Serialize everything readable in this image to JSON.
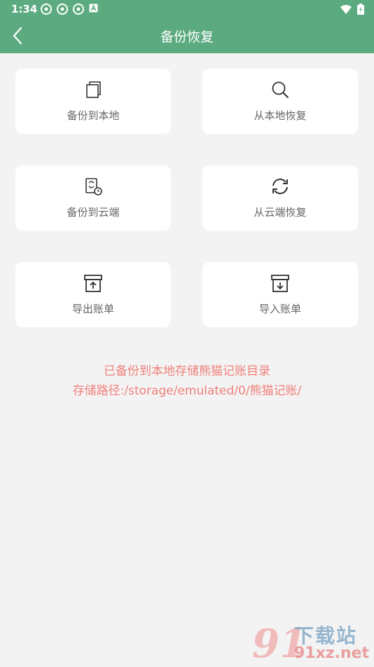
{
  "status": {
    "time": "1:34"
  },
  "header": {
    "title": "备份恢复"
  },
  "cards": [
    {
      "label": "备份到本地"
    },
    {
      "label": "从本地恢复"
    },
    {
      "label": "备份到云端"
    },
    {
      "label": "从云端恢复"
    },
    {
      "label": "导出账单"
    },
    {
      "label": "导入账单"
    }
  ],
  "info": {
    "line1": "已备份到本地存储熊猫记账目录",
    "line2": "存储路径:/storage/emulated/0/熊猫记账/"
  },
  "watermark": {
    "big": "91",
    "top": "下载站",
    "bottom": "91xz.net"
  },
  "colors": {
    "header": "#5cab80",
    "info": "#f0807a",
    "background": "#f3f3f3"
  }
}
